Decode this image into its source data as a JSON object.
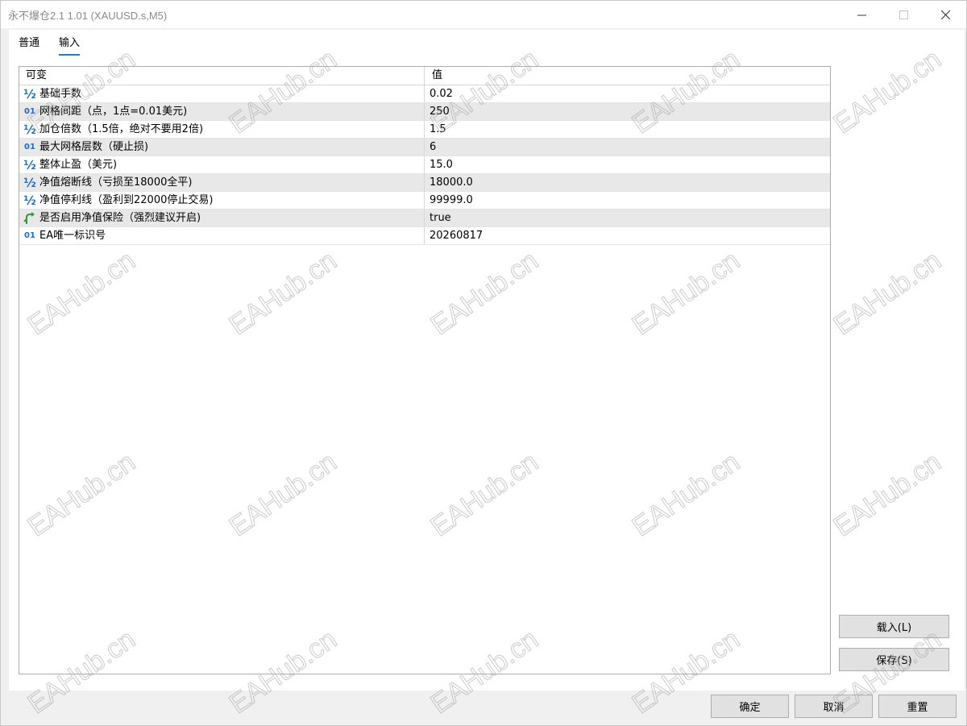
{
  "window": {
    "title": "永不爆仓2.1 1.01 (XAUUSD.s,M5)",
    "controls": {
      "minimize": "—",
      "maximize": "☐",
      "close": "✕"
    }
  },
  "tabs": [
    {
      "label": "普通",
      "active": false
    },
    {
      "label": "输入",
      "active": true
    }
  ],
  "grid": {
    "headers": {
      "name": "可变",
      "value": "值"
    },
    "rows": [
      {
        "type": "double-icon",
        "name": "基础手数",
        "value": "0.02"
      },
      {
        "type": "int-icon",
        "name": "网格间距（点，1点=0.01美元)",
        "value": "250"
      },
      {
        "type": "double-icon",
        "name": "加仓倍数（1.5倍，绝对不要用2倍)",
        "value": "1.5"
      },
      {
        "type": "int-icon",
        "name": "最大网格层数（硬止损)",
        "value": "6"
      },
      {
        "type": "double-icon",
        "name": "整体止盈（美元)",
        "value": "15.0"
      },
      {
        "type": "double-icon",
        "name": "净值熔断线（亏损至18000全平)",
        "value": "18000.0"
      },
      {
        "type": "double-icon",
        "name": "净值停利线（盈利到22000停止交易)",
        "value": "99999.0"
      },
      {
        "type": "bool-icon",
        "name": "是否启用净值保险（强烈建议开启)",
        "value": "true"
      },
      {
        "type": "int-icon",
        "name": "EA唯一标识号",
        "value": "20260817"
      }
    ]
  },
  "icon_glyphs": {
    "double": "½",
    "int": "01"
  },
  "buttons": {
    "load": "载入(L)",
    "save": "保存(S)",
    "ok": "确定",
    "cancel": "取消",
    "reset": "重置"
  },
  "watermark": {
    "text": "EAHub.cn"
  },
  "colors": {
    "accent": "#2a7ab8",
    "icon_blue": "#1f6db8",
    "icon_green": "#2e9a3e"
  }
}
